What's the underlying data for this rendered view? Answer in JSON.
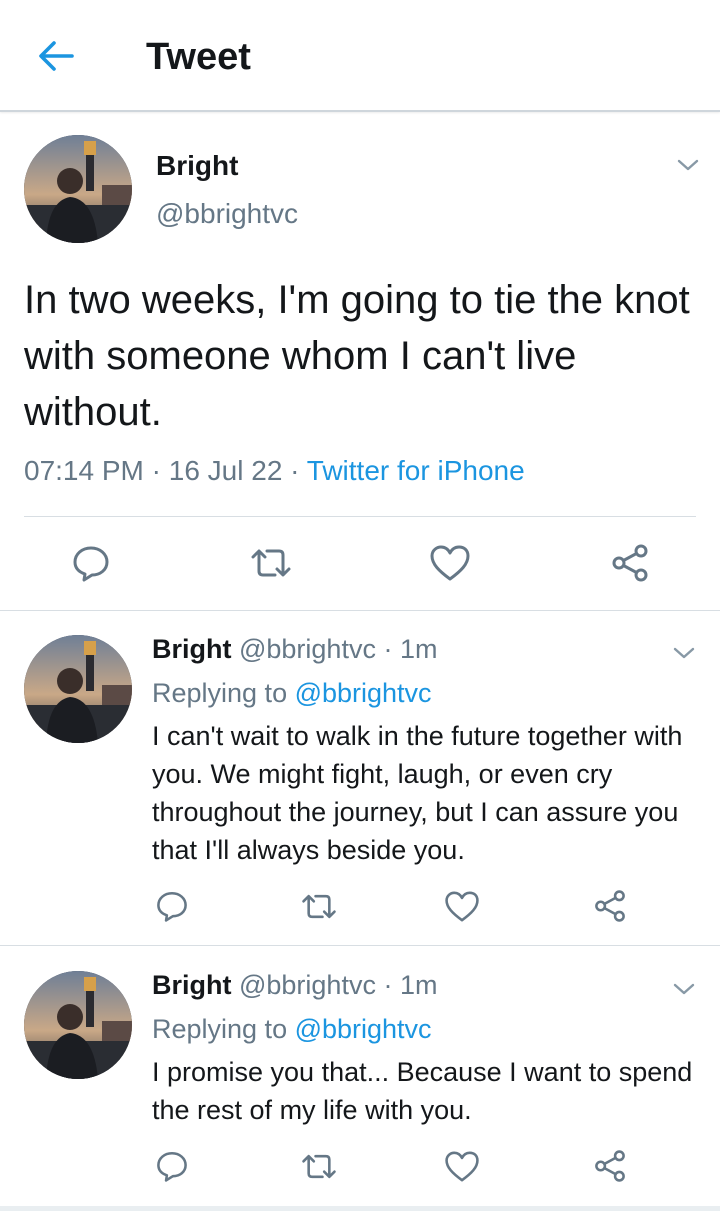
{
  "header": {
    "title": "Tweet",
    "back_icon": "arrow-left-icon"
  },
  "colors": {
    "accent": "#1b95e0",
    "text": "#14171a",
    "muted": "#657786",
    "divider": "#d8dee3"
  },
  "main_tweet": {
    "name": "Bright",
    "handle": "@bbrightvc",
    "text": "In two weeks, I'm going to tie the knot with someone whom I can't live without.",
    "time": "07:14 PM",
    "sep1": " · ",
    "date": "16 Jul 22",
    "sep2": " · ",
    "source": "Twitter for iPhone"
  },
  "replies": [
    {
      "name": "Bright",
      "handle": " @bbrightvc · 1m",
      "replying_prefix": "Replying to ",
      "replying_to": "@bbrightvc",
      "text": "I can't wait to walk in the future together with you. We might fight, laugh, or even cry throughout the journey, but I can assure you that I'll always beside you."
    },
    {
      "name": "Bright",
      "handle": " @bbrightvc · 1m",
      "replying_prefix": "Replying to ",
      "replying_to": "@bbrightvc",
      "text": "I promise you that... Because I want to spend the rest of my life with you."
    }
  ],
  "actions": [
    "reply-icon",
    "retweet-icon",
    "like-icon",
    "share-icon"
  ]
}
